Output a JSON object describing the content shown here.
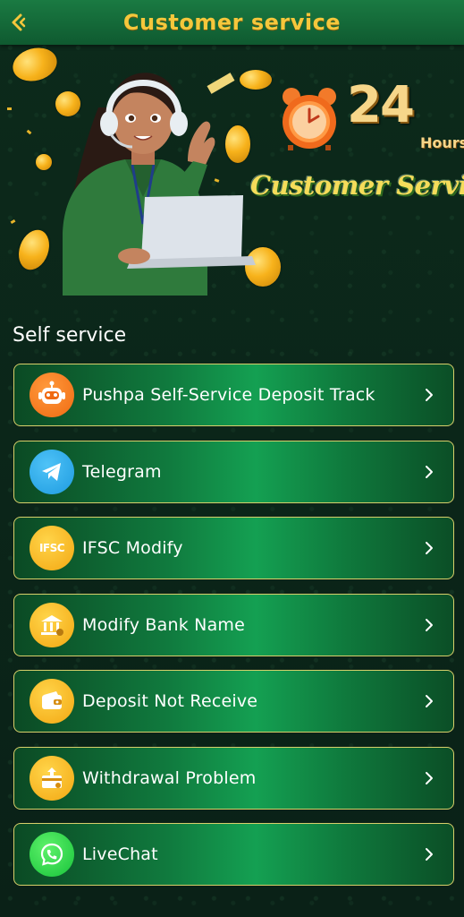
{
  "header": {
    "title": "Customer service",
    "back_icon": "chevron-left-icon",
    "accent": "#f5c73c",
    "bar_color": "#157a40"
  },
  "banner": {
    "big_number": "24",
    "hours_label": "Hours",
    "headline": "Customer Service"
  },
  "section": {
    "title": "Self service"
  },
  "items": [
    {
      "label": "Pushpa Self-Service Deposit Track",
      "icon": "robot-icon"
    },
    {
      "label": "Telegram",
      "icon": "telegram-icon"
    },
    {
      "label": "IFSC Modify",
      "icon": "ifsc-icon",
      "icon_text": "IFSC"
    },
    {
      "label": "Modify Bank Name",
      "icon": "bank-icon"
    },
    {
      "label": "Deposit Not Receive",
      "icon": "wallet-icon"
    },
    {
      "label": "Withdrawal Problem",
      "icon": "withdrawal-icon"
    },
    {
      "label": "LiveChat",
      "icon": "phone-chat-icon"
    }
  ],
  "colors": {
    "item_border": "#d7cf6a",
    "item_gradient_center": "#14a052",
    "background": "#0b2418"
  }
}
